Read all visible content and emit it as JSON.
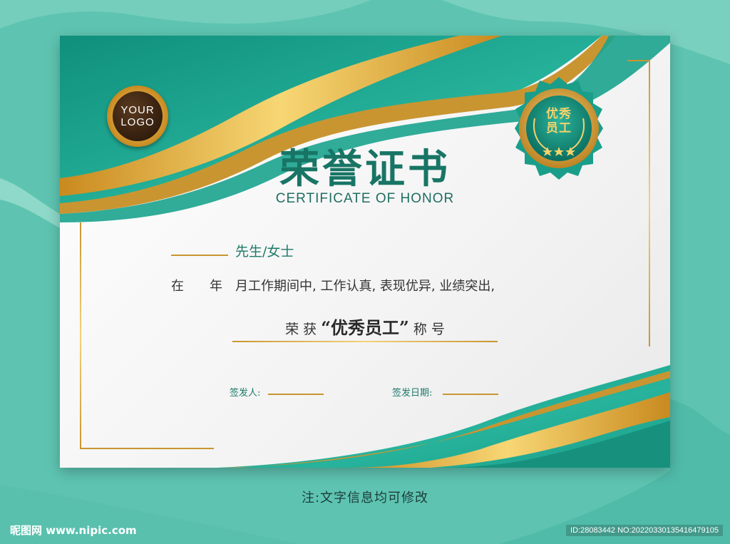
{
  "certificate": {
    "logo_line1": "YOUR",
    "logo_line2": "LOGO",
    "badge_line1": "优秀",
    "badge_line2": "员工",
    "title": "荣誉证书",
    "subtitle": "CERTIFICATE OF HONOR",
    "name_suffix": "先生/女士",
    "body_text": "在　　年　月工作期间中, 工作认真, 表现优异, 业绩突出,",
    "honor_prefix": "荣 获 ",
    "honor_title": "“优秀员工”",
    "honor_suffix": " 称 号",
    "signer_label": "签发人:",
    "date_label": "签发日期:"
  },
  "note": "注:文字信息均可修改",
  "watermark": {
    "site": "昵图网 www.nipic.com",
    "id": "ID:28083442 NO:20220330135416479105"
  },
  "colors": {
    "teal": "#1a9e8a",
    "gold": "#d6a035",
    "title": "#187565",
    "background": "#5ec4b1"
  }
}
